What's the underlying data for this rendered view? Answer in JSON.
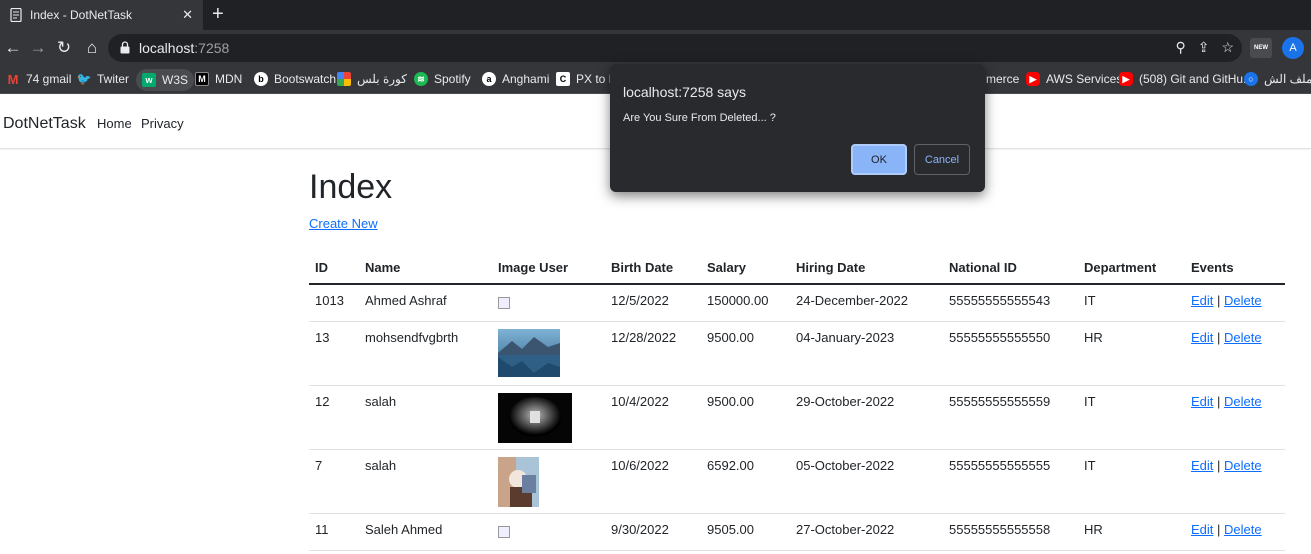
{
  "browser": {
    "tab_title": "Index - DotNetTask",
    "tab_close": "✕",
    "new_tab": "+",
    "url_host": "localhost",
    "url_port": ":7258",
    "ext_badge": "NEW",
    "profile_initial": "A"
  },
  "bookmarks": [
    {
      "label": "74 gmail",
      "icon": "gmail-icon",
      "color": "#ea4335"
    },
    {
      "label": "Twiter",
      "icon": "twitter-icon",
      "color": "#1da1f2"
    },
    {
      "label": "W3S",
      "icon": "w3schools-icon",
      "color": "#04aa6d"
    },
    {
      "label": "MDN",
      "icon": "mdn-icon",
      "color": "#000000"
    },
    {
      "label": "Bootswatch",
      "icon": "bootswatch-icon",
      "color": "#ffffff"
    },
    {
      "label": "كورة بلس",
      "icon": "google-icon",
      "color": "#fbbc05"
    },
    {
      "label": "Spotify",
      "icon": "spotify-icon",
      "color": "#1db954"
    },
    {
      "label": "Anghami",
      "icon": "anghami-icon",
      "color": "#ffffff"
    },
    {
      "label": "PX to R",
      "icon": "c-icon",
      "color": "#ffffff"
    },
    {
      "label": "merce",
      "icon": "",
      "color": ""
    },
    {
      "label": "AWS Services",
      "icon": "youtube-icon",
      "color": "#ff0000"
    },
    {
      "label": "(508) Git and GitHu...",
      "icon": "youtube-icon",
      "color": "#ff0000"
    },
    {
      "label": "ملف الش...",
      "icon": "circle-icon",
      "color": "#1a73e8"
    }
  ],
  "site": {
    "brand": "DotNetTask",
    "nav": [
      "Home",
      "Privacy"
    ]
  },
  "main": {
    "title": "Index",
    "create_link": "Create New"
  },
  "table": {
    "headers": [
      "ID",
      "Name",
      "Image User",
      "Birth Date",
      "Salary",
      "Hiring Date",
      "National ID",
      "Department",
      "Events"
    ],
    "rows": [
      {
        "id": "1013",
        "name": "Ahmed Ashraf",
        "image": "broken",
        "birth": "12/5/2022",
        "salary": "150000.00",
        "hiring": "24-December-2022",
        "nid": "55555555555543",
        "dept": "IT"
      },
      {
        "id": "13",
        "name": "mohsendfvgbrth",
        "image": "lake",
        "birth": "12/28/2022",
        "salary": "9500.00",
        "hiring": "04-January-2023",
        "nid": "55555555555550",
        "dept": "HR"
      },
      {
        "id": "12",
        "name": "salah",
        "image": "dark",
        "birth": "10/4/2022",
        "salary": "9500.00",
        "hiring": "29-October-2022",
        "nid": "55555555555559",
        "dept": "IT"
      },
      {
        "id": "7",
        "name": "salah",
        "image": "person",
        "birth": "10/6/2022",
        "salary": "6592.00",
        "hiring": "05-October-2022",
        "nid": "55555555555555",
        "dept": "IT"
      },
      {
        "id": "11",
        "name": "Saleh Ahmed",
        "image": "broken",
        "birth": "9/30/2022",
        "salary": "9505.00",
        "hiring": "27-October-2022",
        "nid": "55555555555558",
        "dept": "HR"
      }
    ],
    "edit_label": "Edit",
    "separator": "|",
    "delete_label": "Delete"
  },
  "dialog": {
    "title": "localhost:7258 says",
    "message": "Are You Sure From Deleted... ?",
    "ok_label": "OK",
    "cancel_label": "Cancel"
  },
  "colors": {
    "link": "#0d6efd",
    "chrome_dark": "#202124",
    "chrome_mid": "#35363a",
    "dialog_bg": "#292a2d",
    "dialog_ok": "#8ab4f8"
  }
}
